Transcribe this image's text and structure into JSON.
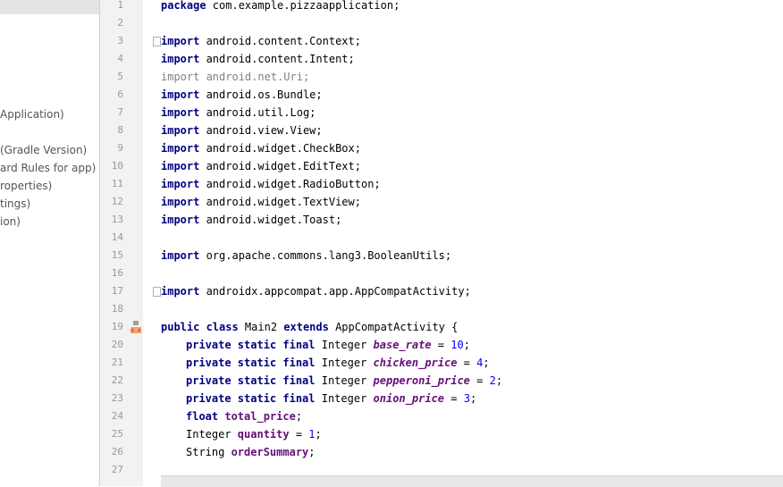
{
  "project_panel": {
    "items": [
      "Application)",
      "(Gradle Version)",
      "ard Rules for app)",
      "roperties)",
      "tings)",
      "ion)"
    ]
  },
  "editor": {
    "line_numbers": [
      "1",
      "2",
      "3",
      "4",
      "5",
      "6",
      "7",
      "8",
      "9",
      "10",
      "11",
      "12",
      "13",
      "14",
      "15",
      "16",
      "17",
      "18",
      "19",
      "20",
      "21",
      "22",
      "23",
      "24",
      "25",
      "26",
      "27"
    ],
    "lines": {
      "l1": {
        "kw": "package",
        "rest": " com.example.pizzaapplication;"
      },
      "l3": {
        "kw": "import",
        "rest": " android.content.Context;"
      },
      "l4": {
        "kw": "import",
        "rest": " android.content.Intent;"
      },
      "l5": {
        "text": "import android.net.Uri;"
      },
      "l6": {
        "kw": "import",
        "rest": " android.os.Bundle;"
      },
      "l7": {
        "kw": "import",
        "rest": " android.util.Log;"
      },
      "l8": {
        "kw": "import",
        "rest": " android.view.View;"
      },
      "l9": {
        "kw": "import",
        "rest": " android.widget.CheckBox;"
      },
      "l10": {
        "kw": "import",
        "rest": " android.widget.EditText;"
      },
      "l11": {
        "kw": "import",
        "rest": " android.widget.RadioButton;"
      },
      "l12": {
        "kw": "import",
        "rest": " android.widget.TextView;"
      },
      "l13": {
        "kw": "import",
        "rest": " android.widget.Toast;"
      },
      "l15": {
        "kw": "import",
        "rest": " org.apache.commons.lang3.BooleanUtils;"
      },
      "l17": {
        "kw": "import",
        "rest": " androidx.appcompat.app.AppCompatActivity;"
      },
      "l19": {
        "kw1": "public class",
        "name": " Main2 ",
        "kw2": "extends",
        "rest": " AppCompatActivity {"
      },
      "l20": {
        "kw": "private static final",
        "type": " Integer ",
        "field": "base_rate",
        "eq": " = ",
        "num": "10",
        "end": ";"
      },
      "l21": {
        "kw": "private static final",
        "type": " Integer ",
        "field": "chicken_price",
        "eq": " = ",
        "num": "4",
        "end": ";"
      },
      "l22": {
        "kw": "private static final",
        "type": " Integer ",
        "field": "pepperoni_price",
        "eq": " = ",
        "num": "2",
        "end": ";"
      },
      "l23": {
        "kw": "private static final",
        "type": " Integer ",
        "field": "onion_price",
        "eq": " = ",
        "num": "3",
        "end": ";"
      },
      "l24": {
        "kw": "float",
        "sp": " ",
        "field": "total_price",
        "end": ";"
      },
      "l25": {
        "type": "Integer ",
        "field": "quantity",
        "eq": " = ",
        "num": "1",
        "end": ";"
      },
      "l26": {
        "type": "String ",
        "field": "orderSummary",
        "end": ";"
      }
    }
  },
  "icons": {
    "fold_marker": "fold-icon",
    "implemented_marker": "android-layout-icon"
  },
  "colors": {
    "keyword": "#000080",
    "field": "#660e7a",
    "number": "#0000ff",
    "unused_import": "#808080",
    "gutter_bg": "#f2f2f2"
  }
}
